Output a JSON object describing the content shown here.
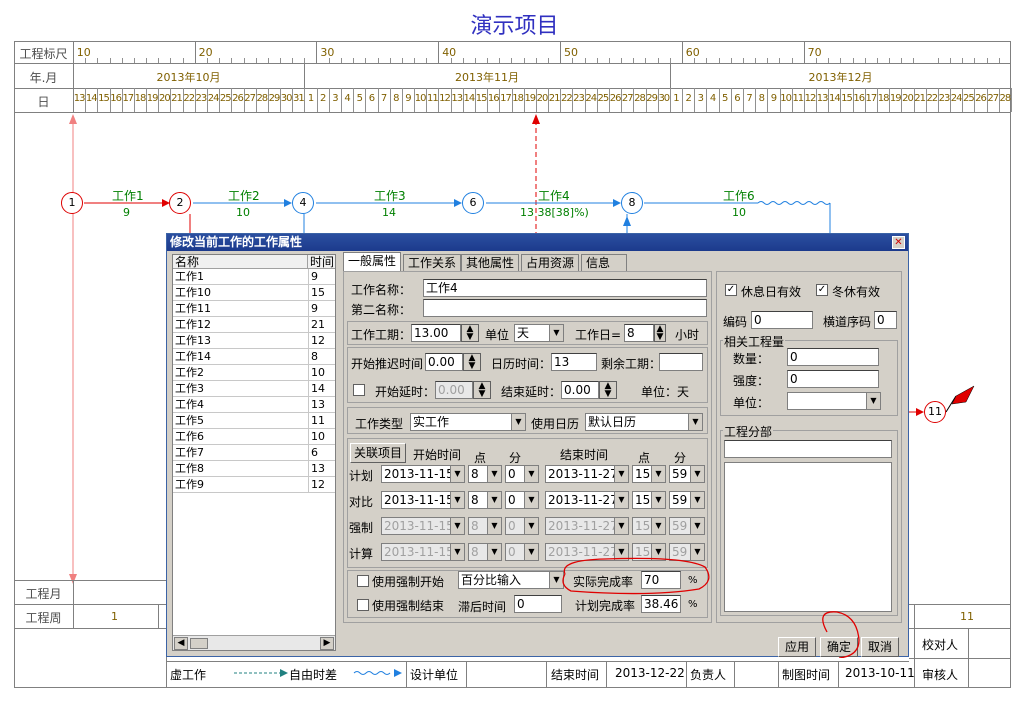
{
  "title": "演示项目",
  "scale": {
    "label_ruler": "工程标尺",
    "label_month": "年.月",
    "label_day": "日",
    "ruler_ticks": [
      "10",
      "20",
      "30",
      "40",
      "50",
      "60",
      "70"
    ],
    "months": [
      "2013年10月",
      "2013年11月",
      "2013年12月"
    ],
    "days": [
      "13",
      "14",
      "15",
      "16",
      "17",
      "18",
      "19",
      "20",
      "21",
      "22",
      "23",
      "24",
      "25",
      "26",
      "27",
      "28",
      "29",
      "30",
      "31",
      "1",
      "2",
      "3",
      "4",
      "5",
      "6",
      "7",
      "8",
      "9",
      "10",
      "11",
      "12",
      "13",
      "14",
      "15",
      "16",
      "17",
      "18",
      "19",
      "20",
      "21",
      "22",
      "23",
      "24",
      "25",
      "26",
      "27",
      "28",
      "29",
      "30",
      "1",
      "2",
      "3",
      "4",
      "5",
      "6",
      "7",
      "8",
      "9",
      "10",
      "11",
      "12",
      "13",
      "14",
      "15",
      "16",
      "17",
      "18",
      "19",
      "20",
      "21",
      "22",
      "23",
      "24",
      "25",
      "26",
      "27",
      "28"
    ]
  },
  "network": {
    "nodes": [
      "1",
      "2",
      "4",
      "6",
      "8",
      "11"
    ],
    "tasks": [
      {
        "name": "工作1",
        "dur": "9"
      },
      {
        "name": "工作2",
        "dur": "10"
      },
      {
        "name": "工作3",
        "dur": "14"
      },
      {
        "name": "工作4",
        "dur": "13 38[38]%)"
      },
      {
        "name": "工作6",
        "dur": "10"
      }
    ]
  },
  "bottom": {
    "label_month": "工程月",
    "label_week": "工程周",
    "week_first": "1",
    "week_last": "11",
    "legend_dummy": "虚工作",
    "legend_float": "自由时差",
    "design_unit": "设计单位",
    "end_time_label": "结束时间",
    "end_time_value": "2013-12-22",
    "owner_label": "负责人",
    "draw_time_label": "制图时间",
    "draw_time_value": "2013-10-11",
    "proofreader": "校对人",
    "reviewer": "审核人"
  },
  "dialog": {
    "title": "修改当前工作的工作属性",
    "list_head_name": "名称",
    "list_head_time": "时间",
    "list": [
      {
        "name": "工作1",
        "time": "9"
      },
      {
        "name": "工作10",
        "time": "15"
      },
      {
        "name": "工作11",
        "time": "9"
      },
      {
        "name": "工作12",
        "time": "21"
      },
      {
        "name": "工作13",
        "time": "12"
      },
      {
        "name": "工作14",
        "time": "8"
      },
      {
        "name": "工作2",
        "time": "10"
      },
      {
        "name": "工作3",
        "time": "14"
      },
      {
        "name": "工作4",
        "time": "13"
      },
      {
        "name": "工作5",
        "time": "11"
      },
      {
        "name": "工作6",
        "time": "10"
      },
      {
        "name": "工作7",
        "time": "6"
      },
      {
        "name": "工作8",
        "time": "13"
      },
      {
        "name": "工作9",
        "time": "12"
      }
    ],
    "tabs": [
      "一般属性",
      "工作关系",
      "其他属性",
      "占用资源",
      "信息"
    ],
    "work_name_label": "工作名称：",
    "work_name": "工作4",
    "second_name_label": "第二名称：",
    "second_name": "",
    "duration_label": "工作工期：",
    "duration": "13.00",
    "unit_label": "单位",
    "unit": "天",
    "workday_label": "工作日=",
    "workday": "8",
    "hour_label": "小时",
    "start_delay_label": "开始推迟时间",
    "start_delay": "0.00",
    "calendar_time_label": "日历时间：",
    "calendar_time": "13",
    "remaining_label": "剩余工期：",
    "remaining": "",
    "start_lag_label": "开始延时：",
    "start_lag": "0.00",
    "end_lag_label": "结束延时：",
    "end_lag": "0.00",
    "unit_day": "单位：天",
    "work_type_label": "工作类型",
    "work_type": "实工作",
    "use_calendar_label": "使用日历",
    "calendar": "默认日历",
    "link_btn": "关联项目",
    "start_time": "开始时间",
    "end_time": "结束时间",
    "point": "点",
    "minute": "分",
    "rows": [
      {
        "label": "计划",
        "sd": "2013-11-15",
        "sh": "8",
        "sm": "0",
        "ed": "2013-11-27",
        "eh": "15",
        "em": "59",
        "dis": false
      },
      {
        "label": "对比",
        "sd": "2013-11-15",
        "sh": "8",
        "sm": "0",
        "ed": "2013-11-27",
        "eh": "15",
        "em": "59",
        "dis": false
      },
      {
        "label": "强制",
        "sd": "2013-11-15",
        "sh": "8",
        "sm": "0",
        "ed": "2013-11-27",
        "eh": "15",
        "em": "59",
        "dis": true
      },
      {
        "label": "计算",
        "sd": "2013-11-15",
        "sh": "8",
        "sm": "0",
        "ed": "2013-11-27",
        "eh": "15",
        "em": "59",
        "dis": true
      }
    ],
    "force_start_label": "使用强制开始",
    "force_end_label": "使用强制结束",
    "percent_input": "百分比输入",
    "actual_rate_label": "实际完成率",
    "actual_rate": "70",
    "pct": "%",
    "lag_time_label": "滞后时间",
    "lag_time": "0",
    "plan_rate_label": "计划完成率",
    "plan_rate": "38.46",
    "rest_valid": "休息日有效",
    "winter_valid": "冬休有效",
    "code_label": "编码",
    "code": "0",
    "lane_label": "横道序码",
    "lane": "0",
    "qty_group": "相关工程量",
    "qty_label": "数量：",
    "qty": "0",
    "intensity_label": "强度：",
    "intensity": "0",
    "unit2_label": "单位：",
    "unit2": "",
    "division_group": "工程分部",
    "division": "",
    "apply_btn": "应用",
    "ok_btn": "确定",
    "cancel_btn": "取消"
  }
}
